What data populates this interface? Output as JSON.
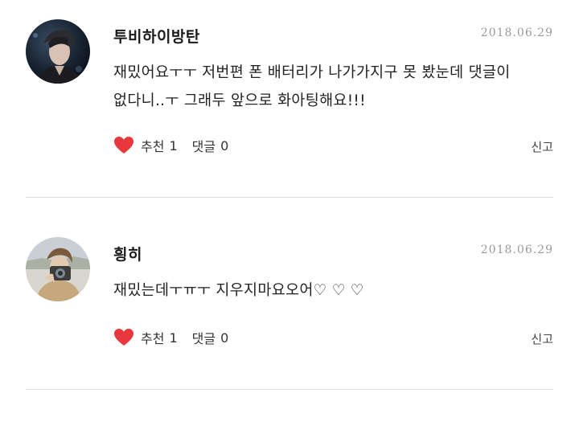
{
  "comments": [
    {
      "username": "투비하이방탄",
      "date": "2018.06.29",
      "text_line1": "재밌어요ㅜㅜ 저번편 폰 배터리가 나가가지구 못 봤눈데 댓글이",
      "text_line2": "없다니..ㅜ 그래두 앞으로 화아팅해요!!!",
      "like_label": "추천",
      "like_count": "1",
      "reply_label": "댓글",
      "reply_count": "0",
      "report_label": "신고",
      "avatar_icon": "profile-photo"
    },
    {
      "username": "힁히",
      "date": "2018.06.29",
      "text_line1": "재밌는데ㅜㅠㅜ 지우지마요오어♡ ♡ ♡",
      "like_label": "추천",
      "like_count": "1",
      "reply_label": "댓글",
      "reply_count": "0",
      "report_label": "신고",
      "avatar_icon": "profile-photo"
    }
  ],
  "colors": {
    "heart": "#e8383d",
    "date": "#9a9a9a",
    "divider": "#e3e3e3",
    "text": "#222222"
  }
}
